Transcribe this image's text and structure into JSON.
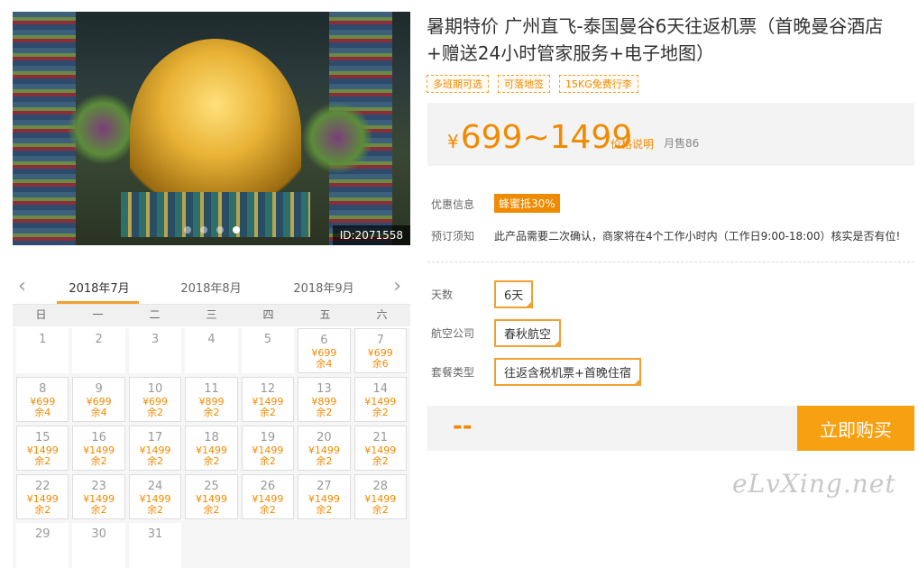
{
  "hero": {
    "id_badge": "ID:2071558",
    "dots": 4,
    "active_dot": 4
  },
  "product": {
    "title": "暑期特价 广州直飞-泰国曼谷6天往返机票（首晚曼谷酒店+赠送24小时管家服务+电子地图）",
    "tags": [
      "多班期可选",
      "可落地签",
      "15KG免费行李"
    ],
    "price_currency": "¥",
    "price_range": "699~1499",
    "price_help": "价格说明",
    "monthly_sales": "月售86"
  },
  "info": {
    "promo_label": "优惠信息",
    "promo_badge": "蜂蜜抵30%",
    "notice_label": "预订须知",
    "notice_text": "此产品需要二次确认，商家将在4个工作小时内（工作日9:00-18:00）核实是否有位!"
  },
  "options": {
    "days_label": "天数",
    "days_value": "6天",
    "airline_label": "航空公司",
    "airline_value": "春秋航空",
    "package_label": "套餐类型",
    "package_value": "往返含税机票+首晚住宿"
  },
  "buy": {
    "placeholder": "--",
    "button": "立即购买"
  },
  "watermark": "eLvXing.net",
  "calendar": {
    "prev": "‹",
    "next": "›",
    "months": [
      "2018年7月",
      "2018年8月",
      "2018年9月"
    ],
    "active_month": 0,
    "weekdays": [
      "日",
      "一",
      "二",
      "三",
      "四",
      "五",
      "六"
    ],
    "days": [
      {
        "d": "1"
      },
      {
        "d": "2"
      },
      {
        "d": "3"
      },
      {
        "d": "4"
      },
      {
        "d": "5"
      },
      {
        "d": "6",
        "price": "¥699",
        "stock": "余4"
      },
      {
        "d": "7",
        "price": "¥699",
        "stock": "余6"
      },
      {
        "d": "8",
        "price": "¥699",
        "stock": "余4"
      },
      {
        "d": "9",
        "price": "¥699",
        "stock": "余4"
      },
      {
        "d": "10",
        "price": "¥699",
        "stock": "余2"
      },
      {
        "d": "11",
        "price": "¥899",
        "stock": "余2"
      },
      {
        "d": "12",
        "price": "¥1499",
        "stock": "余2"
      },
      {
        "d": "13",
        "price": "¥899",
        "stock": "余2"
      },
      {
        "d": "14",
        "price": "¥1499",
        "stock": "余2"
      },
      {
        "d": "15",
        "price": "¥1499",
        "stock": "余2"
      },
      {
        "d": "16",
        "price": "¥1499",
        "stock": "余2"
      },
      {
        "d": "17",
        "price": "¥1499",
        "stock": "余2"
      },
      {
        "d": "18",
        "price": "¥1499",
        "stock": "余2"
      },
      {
        "d": "19",
        "price": "¥1499",
        "stock": "余2"
      },
      {
        "d": "20",
        "price": "¥1499",
        "stock": "余2"
      },
      {
        "d": "21",
        "price": "¥1499",
        "stock": "余2"
      },
      {
        "d": "22",
        "price": "¥1499",
        "stock": "余2"
      },
      {
        "d": "23",
        "price": "¥1499",
        "stock": "余2"
      },
      {
        "d": "24",
        "price": "¥1499",
        "stock": "余2"
      },
      {
        "d": "25",
        "price": "¥1499",
        "stock": "余2"
      },
      {
        "d": "26",
        "price": "¥1499",
        "stock": "余2"
      },
      {
        "d": "27",
        "price": "¥1499",
        "stock": "余2"
      },
      {
        "d": "28",
        "price": "¥1499",
        "stock": "余2"
      },
      {
        "d": "29"
      },
      {
        "d": "30"
      },
      {
        "d": "31"
      }
    ]
  }
}
